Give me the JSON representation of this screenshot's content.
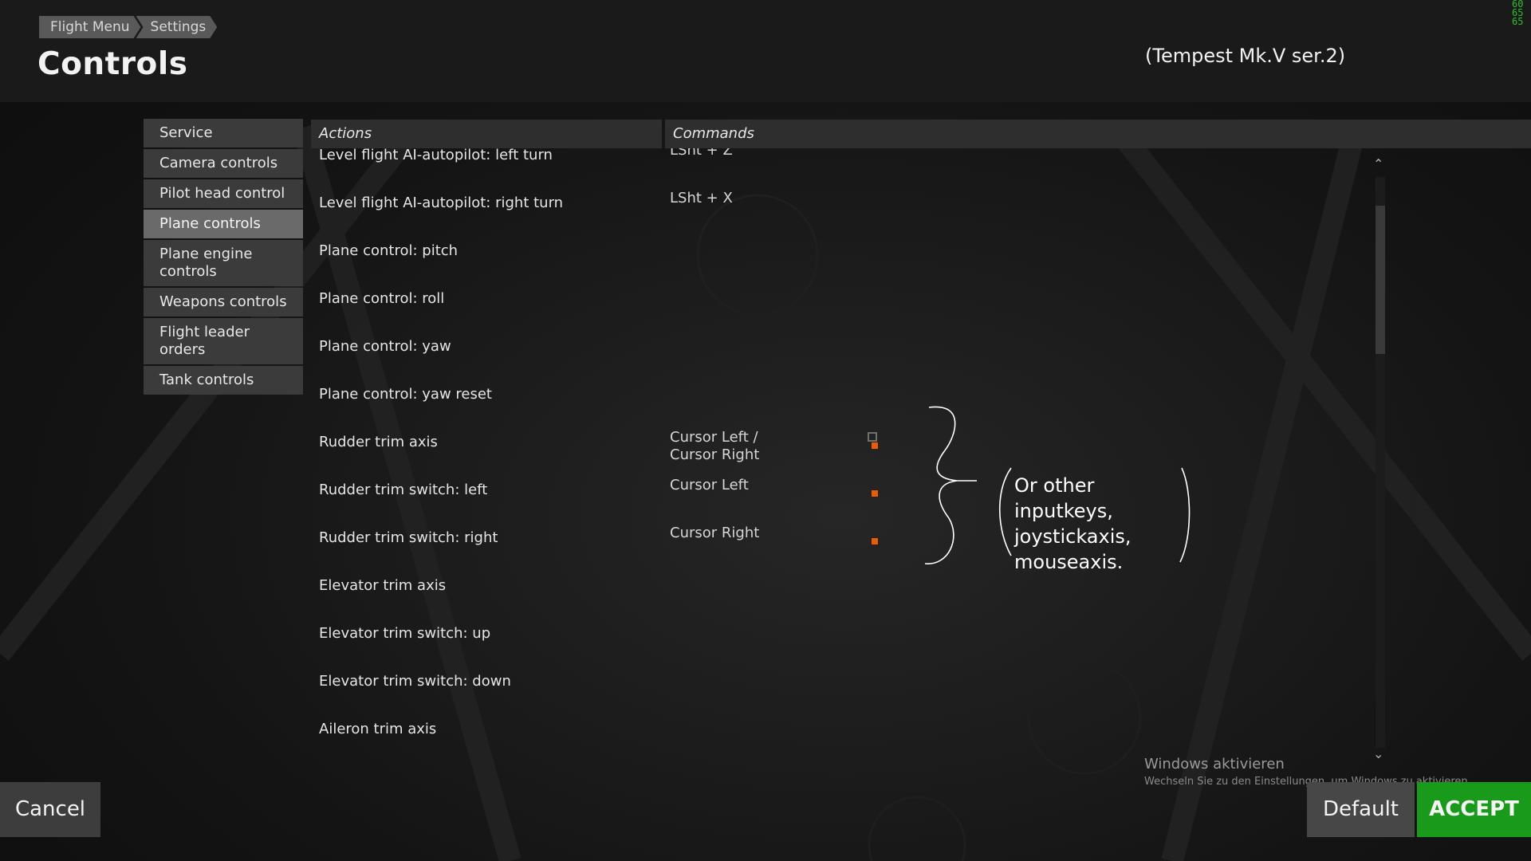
{
  "header": {
    "breadcrumb": [
      "Flight Menu",
      "Settings"
    ],
    "title": "Controls",
    "aircraft": "(Tempest Mk.V ser.2)",
    "fps": [
      "60",
      "65",
      "65"
    ]
  },
  "sidebar": {
    "items": [
      {
        "label": "Service"
      },
      {
        "label": "Camera controls"
      },
      {
        "label": "Pilot head control"
      },
      {
        "label": "Plane controls"
      },
      {
        "label": "Plane engine\ncontrols"
      },
      {
        "label": "Weapons controls"
      },
      {
        "label": "Flight leader orders"
      },
      {
        "label": "Tank controls"
      }
    ],
    "active_label": "Plane controls"
  },
  "table": {
    "col_actions": "Actions",
    "col_commands": "Commands",
    "rows": [
      {
        "action": "Level flight AI-autopilot: left turn",
        "command": "LSht + Z",
        "indicator": false,
        "gicon": false
      },
      {
        "action": "Level flight AI-autopilot: right turn",
        "command": "LSht + X",
        "indicator": false,
        "gicon": false
      },
      {
        "action": "Plane control: pitch",
        "command": "",
        "indicator": false,
        "gicon": false
      },
      {
        "action": "Plane control: roll",
        "command": "",
        "indicator": false,
        "gicon": false
      },
      {
        "action": "Plane control: yaw",
        "command": "",
        "indicator": false,
        "gicon": false
      },
      {
        "action": "Plane control: yaw reset",
        "command": "",
        "indicator": false,
        "gicon": false
      },
      {
        "action": "Rudder trim axis",
        "command": "Cursor Left /\nCursor Right",
        "indicator": true,
        "gicon": true
      },
      {
        "action": "Rudder trim switch: left",
        "command": "Cursor Left",
        "indicator": true,
        "gicon": false
      },
      {
        "action": "Rudder trim switch: right",
        "command": "Cursor Right",
        "indicator": true,
        "gicon": false
      },
      {
        "action": "Elevator trim axis",
        "command": "",
        "indicator": false,
        "gicon": false
      },
      {
        "action": "Elevator trim switch: up",
        "command": "",
        "indicator": false,
        "gicon": false
      },
      {
        "action": "Elevator trim switch: down",
        "command": "",
        "indicator": false,
        "gicon": false
      },
      {
        "action": "Aileron trim axis",
        "command": "",
        "indicator": false,
        "gicon": false
      }
    ]
  },
  "annotation": {
    "lines": [
      "Or other inputkeys,",
      "joystickaxis,",
      "mouseaxis."
    ]
  },
  "watermark": {
    "line1": "Windows aktivieren",
    "line2": "Wechseln Sie zu den Einstellungen, um Windows zu aktivieren."
  },
  "buttons": {
    "cancel": "Cancel",
    "default": "Default",
    "accept": "ACCEPT"
  },
  "colors": {
    "accept_green": "#1a9a1a",
    "indicator_orange": "#e06010",
    "fps_green": "#2fbf2f"
  },
  "icons": [
    "scroll-up-icon",
    "scroll-down-icon",
    "gamepad-icon"
  ]
}
